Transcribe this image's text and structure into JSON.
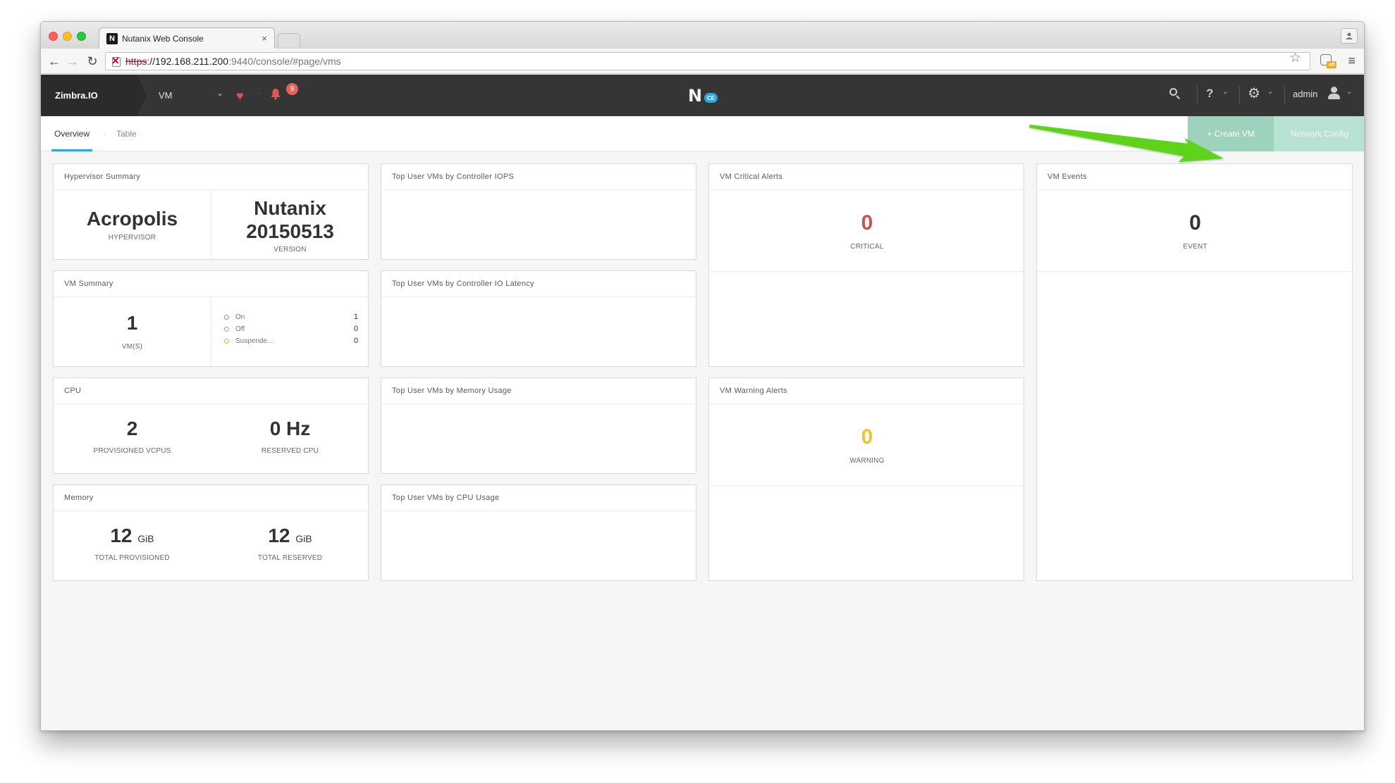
{
  "browser": {
    "tab_title": "Nutanix Web Console",
    "tab_close": "×",
    "url_proto": "https",
    "url_host": "://192.168.211.200",
    "url_path": ":9440/console/#page/vms"
  },
  "header": {
    "brand": "Zimbra.IO",
    "entity": "VM",
    "alert_count": "9",
    "logo_badge": "CE",
    "user": "admin"
  },
  "subnav": {
    "tabs": [
      {
        "label": "Overview"
      },
      {
        "label": "Table"
      }
    ],
    "create_vm": "+  Create VM",
    "network_config": "Network Config"
  },
  "hypervisor_summary": {
    "title": "Hypervisor Summary",
    "hypervisor_value": "Acropolis",
    "hypervisor_label": "HYPERVISOR",
    "version_line1": "Nutanix",
    "version_line2": "20150513",
    "version_label": "VERSION"
  },
  "vm_summary": {
    "title": "VM Summary",
    "count": "1",
    "count_label": "VM(S)",
    "legend": [
      {
        "label": "On",
        "value": "1",
        "color": "#5cb85c"
      },
      {
        "label": "Off",
        "value": "0",
        "color": "#9e9e9e"
      },
      {
        "label": "Suspende...",
        "value": "0",
        "color": "#e2b93b"
      }
    ]
  },
  "cpu": {
    "title": "CPU",
    "provisioned_value": "2",
    "provisioned_label": "PROVISIONED VCPUS",
    "reserved_value": "0 Hz",
    "reserved_label": "RESERVED CPU"
  },
  "memory": {
    "title": "Memory",
    "total_provisioned_value": "12",
    "total_provisioned_unit": "GiB",
    "total_provisioned_label": "TOTAL PROVISIONED",
    "total_reserved_value": "12",
    "total_reserved_unit": "GiB",
    "total_reserved_label": "TOTAL RESERVED"
  },
  "top_vms": {
    "iops_title": "Top User VMs by Controller IOPS",
    "latency_title": "Top User VMs by Controller IO Latency",
    "memory_title": "Top User VMs by Memory Usage",
    "cpu_title": "Top User VMs by CPU Usage"
  },
  "critical_alerts": {
    "title": "VM Critical Alerts",
    "value": "0",
    "label": "CRITICAL",
    "color": "#c9534f"
  },
  "warning_alerts": {
    "title": "VM Warning Alerts",
    "value": "0",
    "label": "WARNING",
    "color": "#f0c330"
  },
  "events": {
    "title": "VM Events",
    "value": "0",
    "label": "EVENT"
  },
  "annotation": {
    "arrow_color": "#5fd31c"
  }
}
